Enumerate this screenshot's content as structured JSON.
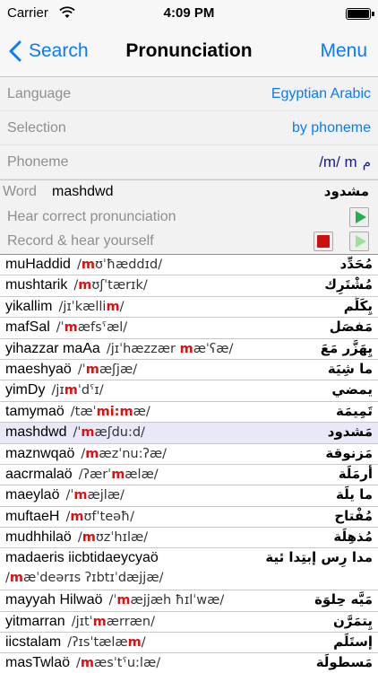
{
  "status": {
    "carrier": "Carrier",
    "time": "4:09 PM"
  },
  "nav": {
    "back_label": "Search",
    "title": "Pronunciation",
    "menu_label": "Menu"
  },
  "settings": {
    "language_label": "Language",
    "language_value": "Egyptian Arabic",
    "selection_label": "Selection",
    "selection_value": "by phoneme",
    "phoneme_label": "Phoneme",
    "phoneme_value": "/m/ m",
    "phoneme_glyph": "م"
  },
  "word_panel": {
    "word_label": "Word",
    "word": "mashdwd",
    "word_arabic": "مشدود",
    "hear_label": "Hear correct pronunciation",
    "record_label": "Record & hear yourself"
  },
  "colors": {
    "accent": "#0a7aff",
    "highlight": "#e01010",
    "play": "#22b14c",
    "stop": "#cc1010"
  },
  "words": [
    {
      "word": "muHaddid",
      "ipa_pre": "/",
      "ipa_hl": "m",
      "ipa_post": "ʊˈħæddɪd/",
      "arabic": "مُحَدِّد"
    },
    {
      "word": "mushtarik",
      "ipa_pre": "/",
      "ipa_hl": "m",
      "ipa_post": "ʊʃˈtærɪk/",
      "arabic": "مُشْتَرِك"
    },
    {
      "word": "yikallim",
      "ipa_pre": "/jɪˈkælli",
      "ipa_hl": "m",
      "ipa_post": "/",
      "arabic": "يِكَلِّم"
    },
    {
      "word": "mafSal",
      "ipa_pre": "/ˈ",
      "ipa_hl": "m",
      "ipa_post": "æfsˤæl/",
      "arabic": "مَفصَل"
    },
    {
      "word": "yihazzar maAa",
      "ipa_pre": "/jɪˈhæzzær ",
      "ipa_hl": "m",
      "ipa_post": "æˈʕæ/",
      "arabic": "يِهَزَّر مَعَ"
    },
    {
      "word": "maeshyaö",
      "ipa_pre": "/ˈ",
      "ipa_hl": "m",
      "ipa_post": "æʃjæ/",
      "arabic": "ما شِيَة"
    },
    {
      "word": "yimDy",
      "ipa_pre": "/jɪ",
      "ipa_hl": "m",
      "ipa_post": "ˈdˤɪ/",
      "arabic": "يمضي"
    },
    {
      "word": "tamymaö",
      "ipa_pre": "/tæˈ",
      "ipa_hl": "mi:m",
      "ipa_post": "æ/",
      "arabic": "تَمِيمَة"
    },
    {
      "word": "mashdwd",
      "ipa_pre": "/ˈ",
      "ipa_hl": "m",
      "ipa_post": "æʃdu:d/",
      "arabic": "مَشدود",
      "selected": true
    },
    {
      "word": "maznwqaö",
      "ipa_pre": "/",
      "ipa_hl": "m",
      "ipa_post": "æzˈnu:ʔæ/",
      "arabic": "مَزنوقة"
    },
    {
      "word": "aacrmalaö",
      "ipa_pre": "/ʔærˈ",
      "ipa_hl": "m",
      "ipa_post": "ælæ/",
      "arabic": "أرمَلَة"
    },
    {
      "word": "maeylaö",
      "ipa_pre": "/ˈ",
      "ipa_hl": "m",
      "ipa_post": "æjlæ/",
      "arabic": "ما يلَة"
    },
    {
      "word": "muftaeH",
      "ipa_pre": "/",
      "ipa_hl": "m",
      "ipa_post": "ʊfˈteəħ/",
      "arabic": "مُفْتاح"
    },
    {
      "word": "mudhhilaö",
      "ipa_pre": "/",
      "ipa_hl": "m",
      "ipa_post": "ʊzˈhɪlæ/",
      "arabic": "مُذهِلَة"
    },
    {
      "word": "madaeris iicbtidaeycyaö",
      "ipa_pre": "/",
      "ipa_hl": "m",
      "ipa_post": "æˈdeərɪs ʔɪbtɪˈdæjjæ/",
      "arabic": "مدا رِس إبتِدا ئية",
      "tall": true
    },
    {
      "word": "mayyah Hilwaö",
      "ipa_pre": "/ˈ",
      "ipa_hl": "m",
      "ipa_post": "æjjæh ħɪlˈwæ/",
      "arabic": "مَيَّه حِلوَة"
    },
    {
      "word": "yitmarran",
      "ipa_pre": "/jɪtˈ",
      "ipa_hl": "m",
      "ipa_post": "ærræn/",
      "arabic": "يِتمَرَّن"
    },
    {
      "word": "iicstalam",
      "ipa_pre": "/ʔɪsˈtælæ",
      "ipa_hl": "m",
      "ipa_post": "/",
      "arabic": "إستَلَم"
    },
    {
      "word": "masTwlaö",
      "ipa_pre": "/",
      "ipa_hl": "m",
      "ipa_post": "æsˈtˤu:læ/",
      "arabic": "مَسطولَة"
    }
  ]
}
